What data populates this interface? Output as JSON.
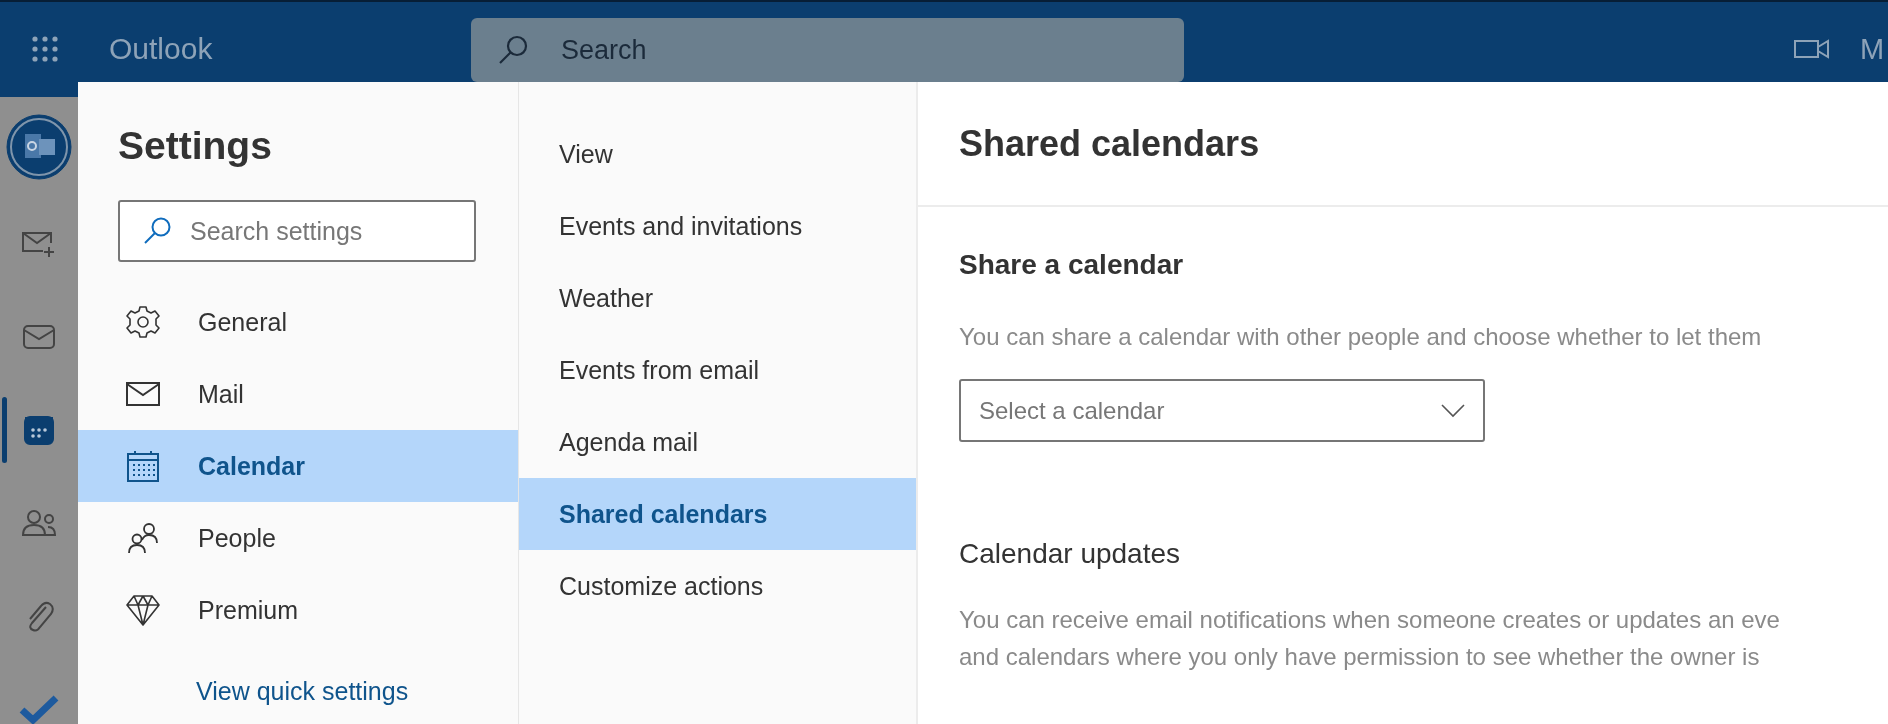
{
  "top_bar": {
    "app_name": "Outlook",
    "search": {
      "placeholder": "Search"
    },
    "account_label": "M"
  },
  "rail": [
    {
      "kind": "app-logo",
      "selected": false
    },
    {
      "kind": "new-mail",
      "selected": false
    },
    {
      "kind": "mail",
      "selected": false
    },
    {
      "kind": "calendar",
      "selected": true
    },
    {
      "kind": "people",
      "selected": false
    },
    {
      "kind": "files",
      "selected": false
    },
    {
      "kind": "todo",
      "selected": false
    }
  ],
  "settings": {
    "title": "Settings",
    "search": {
      "placeholder": "Search settings"
    },
    "categories": [
      {
        "kind": "general",
        "label": "General",
        "selected": false
      },
      {
        "kind": "mail",
        "label": "Mail",
        "selected": false
      },
      {
        "kind": "calendar",
        "label": "Calendar",
        "selected": true
      },
      {
        "kind": "people",
        "label": "People",
        "selected": false
      },
      {
        "kind": "premium",
        "label": "Premium",
        "selected": false
      }
    ],
    "quick_settings_link": "View quick settings"
  },
  "subsections": [
    {
      "label": "View",
      "selected": false
    },
    {
      "label": "Events and invitations",
      "selected": false
    },
    {
      "label": "Weather",
      "selected": false
    },
    {
      "label": "Events from email",
      "selected": false
    },
    {
      "label": "Agenda mail",
      "selected": false
    },
    {
      "label": "Shared calendars",
      "selected": true
    },
    {
      "label": "Customize actions",
      "selected": false
    }
  ],
  "content": {
    "title": "Shared calendars",
    "share": {
      "heading": "Share a calendar",
      "description": "You can share a calendar with other people and choose whether to let them",
      "dropdown": {
        "placeholder": "Select a calendar"
      }
    },
    "updates": {
      "heading": "Calendar updates",
      "description_lines": [
        "You can receive email notifications when someone creates or updates an eve",
        "and calendars where you only have permission to see whether the owner is"
      ]
    }
  }
}
